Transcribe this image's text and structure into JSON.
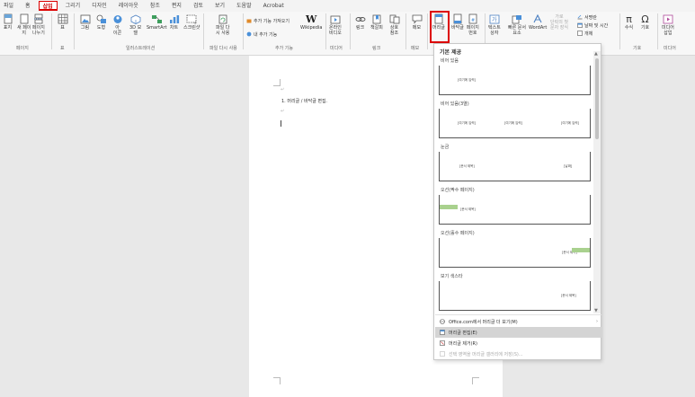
{
  "tabs": [
    "파일",
    "홈",
    "삽입",
    "그리기",
    "디자인",
    "레이아웃",
    "참조",
    "편지",
    "검토",
    "보기",
    "도움말",
    "Acrobat"
  ],
  "active_tab": "삽입",
  "ribbon": {
    "cover_page": "표지",
    "blank_page": "새 페이\n지",
    "page_break": "페이지\n나누기",
    "table": "표",
    "pictures": "그림",
    "shapes": "도형",
    "icons": "아\n이콘",
    "models_3d": "3D 모\n델",
    "smartart": "SmartArt",
    "chart": "차트",
    "screenshot": "스크린샷",
    "reuse_files": "파일 다\n시 사용",
    "get_addins": "추가 기능 가져오기",
    "my_addins": "내 추가 기능",
    "wikipedia": "Wikipedia",
    "online_video": "온라인\n비디오",
    "link": "링크",
    "bookmark": "책갈피",
    "cross_ref": "상호\n참조",
    "comment": "메모",
    "header": "머리글",
    "footer": "바닥글",
    "page_number": "페이지\n번호",
    "text_box": "텍스트\n상자",
    "quick_parts": "빠른 문서\n요소",
    "wordart": "WordArt",
    "drop_cap": "가로\n단락의 첫\n문자 장식",
    "signature_line": "서명란",
    "date_time": "날짜 및 시간",
    "object": "개체",
    "equation": "수식",
    "symbol": "기호",
    "media": "미디어\n삽입"
  },
  "groups": {
    "pages": "페이지",
    "tables": "표",
    "illustrations": "일러스트레이션",
    "reuse": "파일 다시 사용",
    "addins": "추가 기능",
    "media": "미디어",
    "links": "링크",
    "comments": "메모",
    "symbols": "기호",
    "media2": "미디어"
  },
  "document": {
    "line": "1. 머리글 / 바닥글 편집."
  },
  "gallery": {
    "heading": "기본 제공",
    "sections": [
      {
        "name": "비어 있음",
        "placeholders": [
          "[여기에 입력]"
        ]
      },
      {
        "name": "비어 있음(3열)",
        "placeholders": [
          "[여기에 입력]",
          "[여기에 입력]",
          "[여기에 입력]"
        ]
      },
      {
        "name": "눈금",
        "placeholders": [
          "[문서 제목]",
          "[날짜]"
        ]
      },
      {
        "name": "오선(짝수 페이지)",
        "placeholders": [
          "[문서 제목]"
        ]
      },
      {
        "name": "오선(홀수 페이지)",
        "placeholders": [
          "[문서 제목]"
        ]
      },
      {
        "name": "보기 색스타",
        "placeholders": [
          "[문서 제목]"
        ]
      }
    ],
    "accent_color": "#a9d18e"
  },
  "menu": {
    "more": "Office.com에서 머리글 더 보기(M)",
    "edit": "머리글 편집(E)",
    "remove": "머리글 제거(R)",
    "save": "선택 영역을 머리글 갤러리에 저장(S)..."
  },
  "colors": {
    "highlight": "#dd0000",
    "active_tab": "#cc0000"
  }
}
